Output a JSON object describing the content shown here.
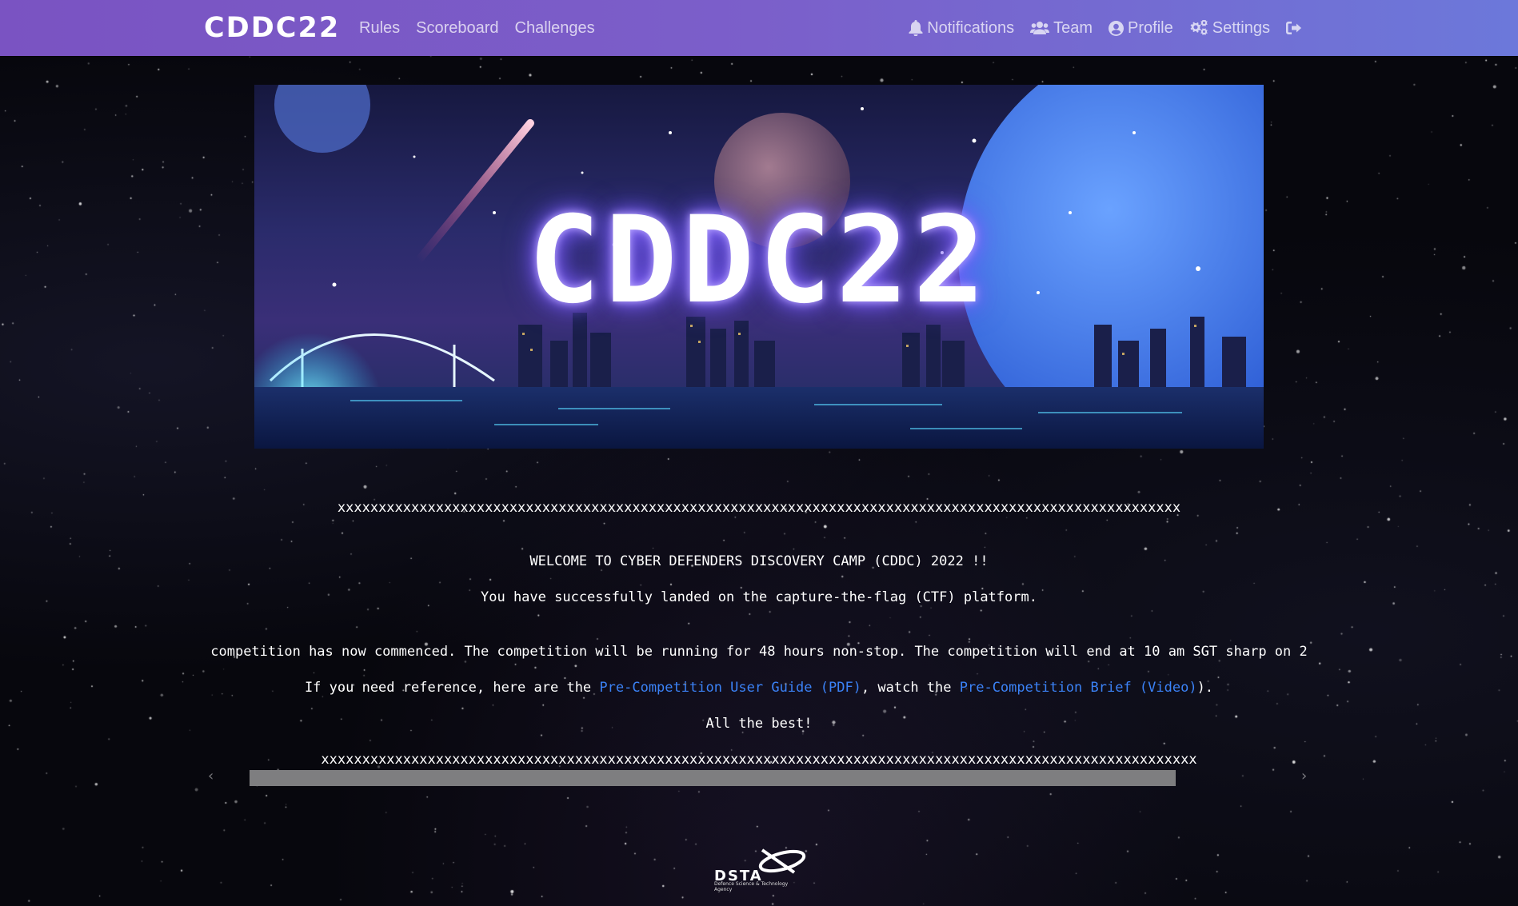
{
  "navbar": {
    "brand": "CDDC22",
    "left_links": [
      {
        "label": "Rules"
      },
      {
        "label": "Scoreboard"
      },
      {
        "label": "Challenges"
      }
    ],
    "right_links": [
      {
        "label": "Notifications",
        "icon": "bell-icon"
      },
      {
        "label": "Team",
        "icon": "users-icon"
      },
      {
        "label": "Profile",
        "icon": "user-circle-icon"
      },
      {
        "label": "Settings",
        "icon": "gears-icon"
      }
    ],
    "logout_icon": "sign-out-icon"
  },
  "banner": {
    "title": "CDDC22"
  },
  "content": {
    "divider_top": "xxxxxxxxxxxxxxxxxxxxxxxxxxxxxxxxxxxxxxxxxxxxxxxxxxxxxxxxxxxxxxxxxxxxxxxxxxxxxxxxxxxxxxxxxxxxxxxxxxxxxxx",
    "welcome": "WELCOME TO CYBER DEFENDERS DISCOVERY CAMP (CDDC) 2022 !!",
    "landed": "You have successfully landed on the capture-the-flag (CTF) platform.",
    "commenced": "competition has now commenced. The competition will be running for 48 hours non-stop. The competition will end at 10 am SGT sharp on 2",
    "reference_prefix": "If you need reference, here are the ",
    "user_guide_link": "Pre-Competition User Guide (PDF)",
    "reference_middle": ", watch the ",
    "brief_link": "Pre-Competition Brief (Video)",
    "reference_suffix": ").",
    "all_the_best": "All the best!",
    "divider_bottom": "xxxxxxxxxxxxxxxxxxxxxxxxxxxxxxxxxxxxxxxxxxxxxxxxxxxxxxxxxxxxxxxxxxxxxxxxxxxxxxxxxxxxxxxxxxxxxxxxxxxxxxxxxxx",
    "scroll_left": "‹",
    "scroll_right": "›"
  },
  "footer": {
    "logo_name": "DSTA",
    "logo_sub": "Defence Science & Technology Agency"
  },
  "colors": {
    "navbar_start": "#7a53c2",
    "navbar_end": "#6c78da",
    "link": "#3b82f6",
    "background": "#07070d"
  }
}
